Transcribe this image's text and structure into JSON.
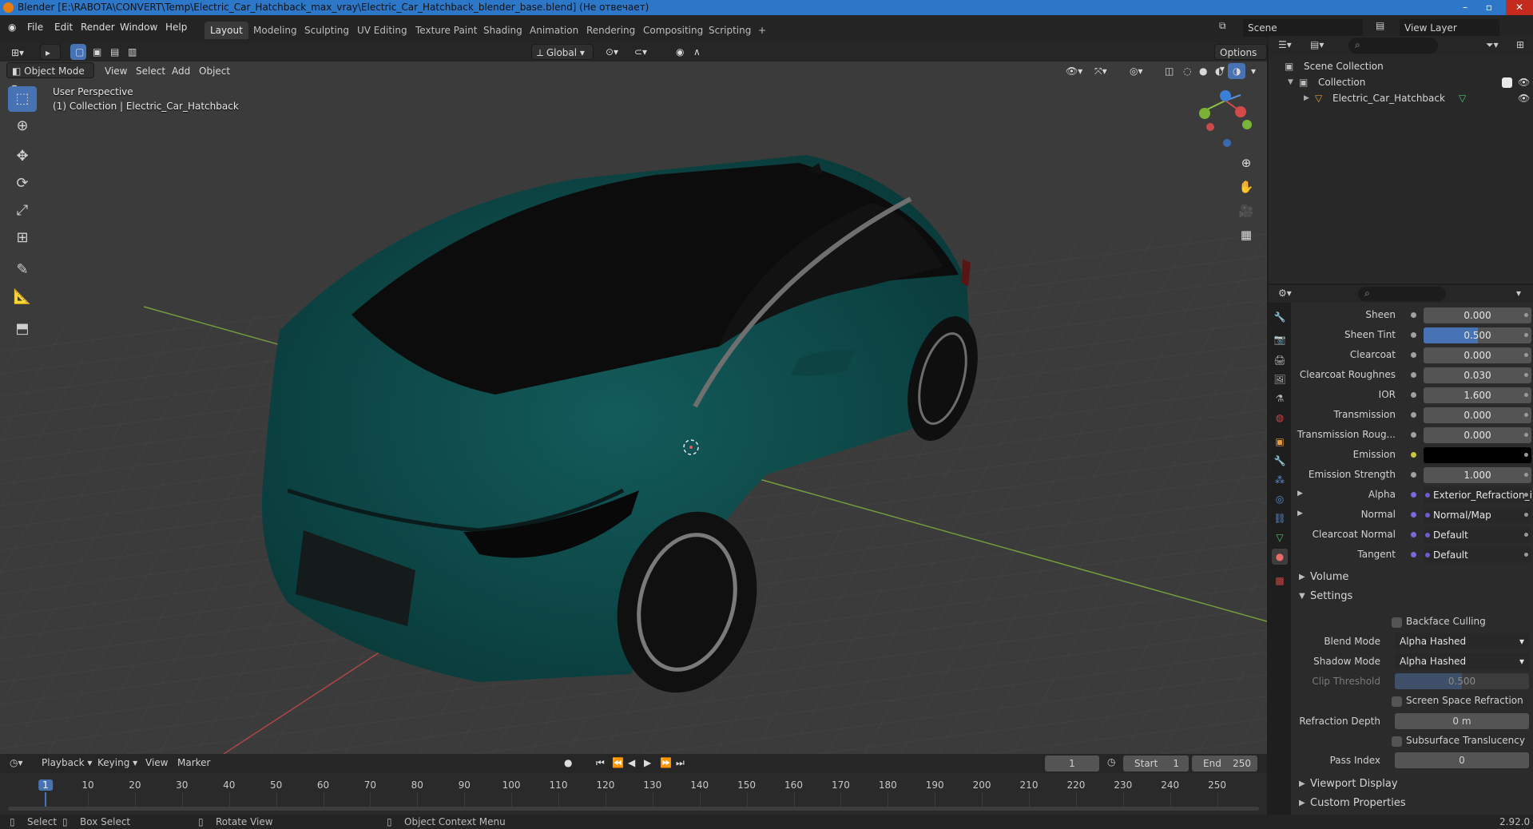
{
  "window": {
    "title": "Blender [E:\\RABOTA\\CONVERT\\Temp\\Electric_Car_Hatchback_max_vray\\Electric_Car_Hatchback_blender_base.blend] (Не отвечает)",
    "controls": [
      "–",
      "▫",
      "✕"
    ]
  },
  "menu": [
    "File",
    "Edit",
    "Render",
    "Window",
    "Help"
  ],
  "workspaces": [
    "Layout",
    "Modeling",
    "Sculpting",
    "UV Editing",
    "Texture Paint",
    "Shading",
    "Animation",
    "Rendering",
    "Compositing",
    "Scripting",
    "+"
  ],
  "scene": {
    "name": "Scene",
    "view_layer": "View Layer"
  },
  "viewport_header": {
    "mode": "Object Mode",
    "menus": [
      "View",
      "Select",
      "Add",
      "Object"
    ],
    "transform_orientation": "Global",
    "options_label": "Options"
  },
  "viewport": {
    "perspective_label": "User Perspective",
    "collection_label": "(1) Collection | Electric_Car_Hatchback",
    "gizmo_axes": [
      "X",
      "Y",
      "Z"
    ]
  },
  "outliner": {
    "items": [
      {
        "label": "Scene Collection"
      },
      {
        "label": "Collection"
      },
      {
        "label": "Electric_Car_Hatchback"
      }
    ]
  },
  "properties": {
    "rows": [
      {
        "label": "Sheen",
        "value": "0.000",
        "kind": "number"
      },
      {
        "label": "Sheen Tint",
        "value": "0.500",
        "kind": "slider",
        "fill": 0.5
      },
      {
        "label": "Clearcoat",
        "value": "0.000",
        "kind": "number"
      },
      {
        "label": "Clearcoat Roughnes",
        "value": "0.030",
        "kind": "number"
      },
      {
        "label": "IOR",
        "value": "1.600",
        "kind": "number"
      },
      {
        "label": "Transmission",
        "value": "0.000",
        "kind": "number"
      },
      {
        "label": "Transmission Roug...",
        "value": "0.000",
        "kind": "number"
      },
      {
        "label": "Emission",
        "value": "",
        "kind": "color",
        "color": "#000000"
      },
      {
        "label": "Emission Strength",
        "value": "1.000",
        "kind": "number"
      },
      {
        "label": "Alpha",
        "value": "Exterior_Refraction_inver...",
        "kind": "link"
      },
      {
        "label": "Normal",
        "value": "Normal/Map",
        "kind": "link"
      },
      {
        "label": "Clearcoat Normal",
        "value": "Default",
        "kind": "link"
      },
      {
        "label": "Tangent",
        "value": "Default",
        "kind": "link"
      }
    ],
    "panels": {
      "volume": "Volume",
      "settings": "Settings",
      "viewport_display": "Viewport Display",
      "custom_properties": "Custom Properties"
    },
    "settings": {
      "backface_culling": "Backface Culling",
      "blend_mode_label": "Blend Mode",
      "blend_mode_value": "Alpha Hashed",
      "shadow_mode_label": "Shadow Mode",
      "shadow_mode_value": "Alpha Hashed",
      "clip_threshold_label": "Clip Threshold",
      "clip_threshold_value": "0.500",
      "screen_space_refraction": "Screen Space Refraction",
      "refraction_depth_label": "Refraction Depth",
      "refraction_depth_value": "0 m",
      "subsurface_translucency": "Subsurface Translucency",
      "pass_index_label": "Pass Index",
      "pass_index_value": "0"
    }
  },
  "timeline": {
    "menus": [
      "Playback",
      "Keying",
      "View",
      "Marker"
    ],
    "current_frame": "1",
    "start_label": "Start",
    "start": "1",
    "end_label": "End",
    "end": "250",
    "ticks": [
      "1",
      "10",
      "20",
      "30",
      "40",
      "50",
      "60",
      "70",
      "80",
      "90",
      "100",
      "110",
      "120",
      "130",
      "140",
      "150",
      "160",
      "170",
      "180",
      "190",
      "200",
      "210",
      "220",
      "230",
      "240",
      "250"
    ]
  },
  "statusbar": {
    "select": "Select",
    "box_select": "Box Select",
    "rotate_view": "Rotate View",
    "context_menu": "Object Context Menu",
    "version": "2.92.0"
  },
  "colors": {
    "accent": "#4772b3",
    "car_body": "#0e4a4a",
    "axis_x": "#c94a4a",
    "axis_y": "#8cc63f"
  }
}
